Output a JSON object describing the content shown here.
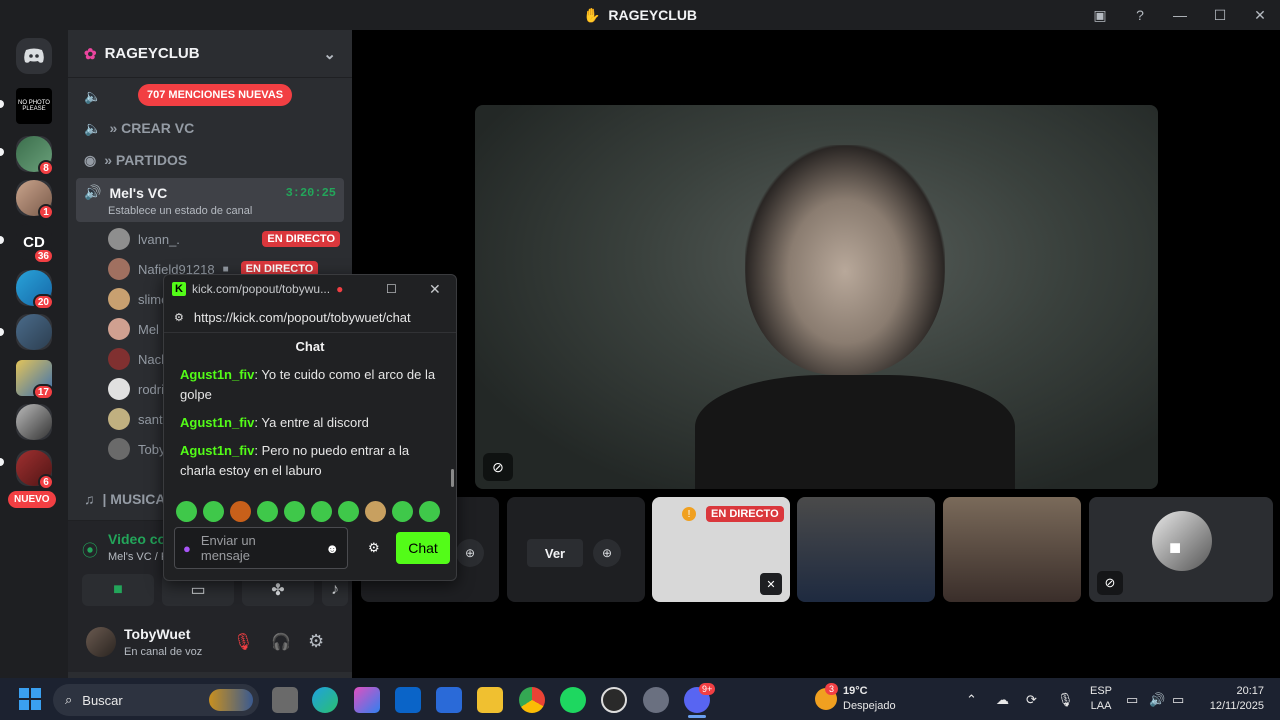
{
  "window": {
    "title": "RAGEYCLUB"
  },
  "guild_badges": [
    "8",
    "1",
    "36",
    "20",
    "17",
    "6"
  ],
  "guild_labels": {
    "cd": "CD",
    "nuevo": "NUEVO"
  },
  "server": {
    "name": "RAGEYCLUB"
  },
  "mentions": {
    "label": "707 MENCIONES NUEVAS"
  },
  "channels": [
    {
      "label": "» CREAR VC"
    },
    {
      "label": "» PARTIDOS"
    },
    {
      "label": "| MUSICA |"
    }
  ],
  "active_channel": {
    "name": "Mel's VC",
    "timer": "3:20:25",
    "status": "Establece un estado de canal"
  },
  "voice_users": [
    {
      "name": "lvann_.",
      "live": "EN DIRECTO"
    },
    {
      "name": "Nafield91218",
      "live": "EN DIRECTO"
    },
    {
      "name": "slime"
    },
    {
      "name": "Mel"
    },
    {
      "name": "Nach"
    },
    {
      "name": "rodri"
    },
    {
      "name": "santi"
    },
    {
      "name": "Toby"
    }
  ],
  "voice_status": {
    "title": "Video conectado",
    "subtitle": "Mel's VC / RAGEYCLUB"
  },
  "user_panel": {
    "name": "TobyWuet",
    "status": "En canal de voz"
  },
  "popup": {
    "tab_title": "kick.com/popout/tobywu...",
    "url": "https://kick.com/popout/tobywuet/chat",
    "header": "Chat",
    "messages": [
      {
        "user": "Agust1n_fiv",
        "text": "Yo te cuido como el arco de la golpe"
      },
      {
        "user": "Agust1n_fiv",
        "text": "Ya entre al discord"
      },
      {
        "user": "Agust1n_fiv",
        "text": "Pero no puedo entrar a la charla estoy en el laburo"
      }
    ],
    "input_placeholder": "Enviar un mensaje",
    "send_label": "Chat"
  },
  "tiles": {
    "watch_label": "Ver",
    "live_label": "EN DIRECTO"
  },
  "taskbar": {
    "search_label": "Buscar",
    "weather_temp": "19°C",
    "weather_desc": "Despejado",
    "weather_badge": "3",
    "discord_badge": "9+",
    "lang1": "ESP",
    "lang2": "LAA",
    "time": "20:17",
    "date": "12/11/2025"
  },
  "colors": {
    "discord_bg": "#2b2d31",
    "live_red": "#da373c",
    "kick_green": "#53fc18",
    "connected_green": "#23a55a"
  }
}
